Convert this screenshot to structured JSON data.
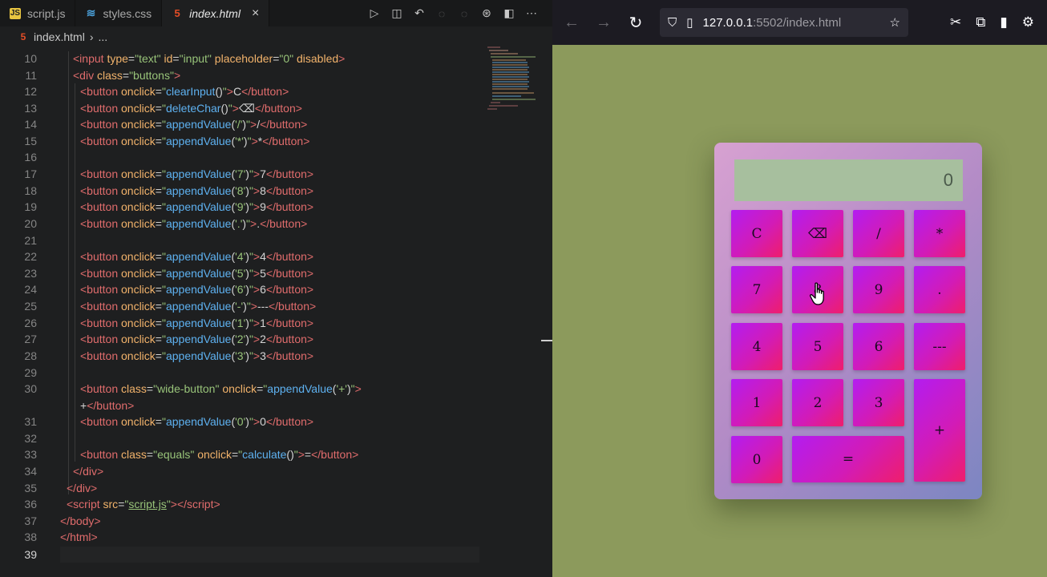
{
  "editor": {
    "tabs": [
      {
        "label": "script.js",
        "icon": "js-icon"
      },
      {
        "label": "styles.css",
        "icon": "css-icon"
      },
      {
        "label": "index.html",
        "icon": "html-icon",
        "active": true
      }
    ],
    "tab_close": "×",
    "breadcrumb": {
      "file": "index.html",
      "sep": "›",
      "more": "..."
    },
    "lines": [
      {
        "n": "10"
      },
      {
        "n": "11"
      },
      {
        "n": "12"
      },
      {
        "n": "13"
      },
      {
        "n": "14"
      },
      {
        "n": "15"
      },
      {
        "n": "16"
      },
      {
        "n": "17"
      },
      {
        "n": "18"
      },
      {
        "n": "19"
      },
      {
        "n": "20"
      },
      {
        "n": "21"
      },
      {
        "n": "22"
      },
      {
        "n": "23"
      },
      {
        "n": "24"
      },
      {
        "n": "25"
      },
      {
        "n": "26"
      },
      {
        "n": "27"
      },
      {
        "n": "28"
      },
      {
        "n": "29"
      },
      {
        "n": "30"
      },
      {
        "n": "31"
      },
      {
        "n": "32"
      },
      {
        "n": "33"
      },
      {
        "n": "34"
      },
      {
        "n": "35"
      },
      {
        "n": "36"
      },
      {
        "n": "37"
      },
      {
        "n": "38"
      },
      {
        "n": "39"
      }
    ]
  },
  "browser": {
    "url_host": "127.0.0.1",
    "url_rest": ":5502/index.html"
  },
  "calculator": {
    "placeholder": "0",
    "buttons": {
      "clear": "C",
      "delete": "⌫",
      "divide": "/",
      "multiply": "*",
      "seven": "7",
      "eight": "8",
      "nine": "9",
      "dot": ".",
      "four": "4",
      "five": "5",
      "six": "6",
      "minus": "---",
      "one": "1",
      "two": "2",
      "three": "3",
      "plus": "+",
      "zero": "0",
      "equals": "="
    }
  }
}
